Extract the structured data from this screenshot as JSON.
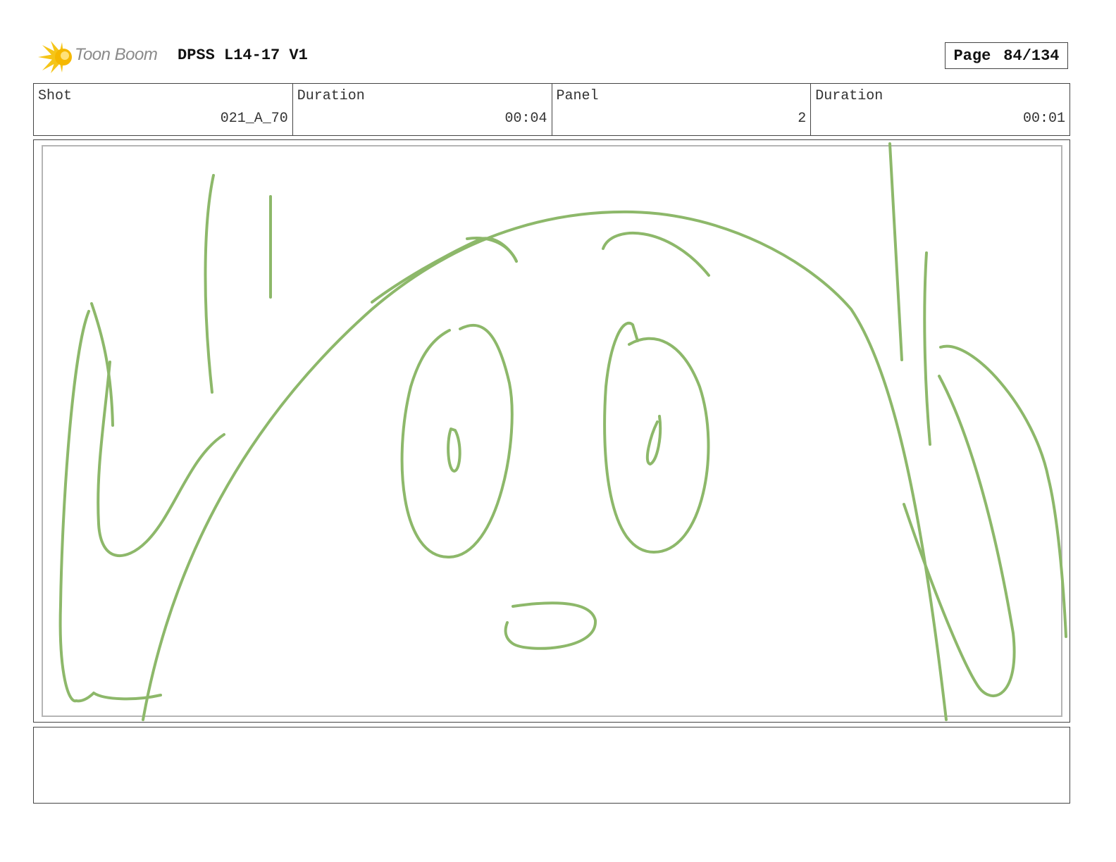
{
  "header": {
    "brand": "Toon Boom",
    "title": "DPSS L14-17 V1",
    "page_label": "Page",
    "page_value": "84/134"
  },
  "info": {
    "shot_label": "Shot",
    "shot_value": "021_A_70",
    "shot_duration_label": "Duration",
    "shot_duration_value": "00:04",
    "panel_label": "Panel",
    "panel_value": "2",
    "panel_duration_label": "Duration",
    "panel_duration_value": "00:01"
  },
  "colors": {
    "sketch_stroke": "#8db86a",
    "logo_yellow": "#f5c518",
    "border": "#444444"
  },
  "icons": {
    "logo": "toon-boom-starburst-icon"
  },
  "notes": ""
}
